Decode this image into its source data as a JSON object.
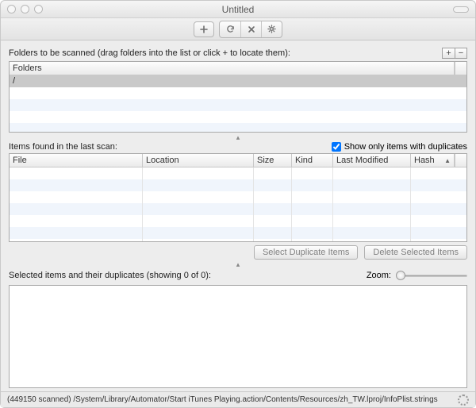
{
  "window": {
    "title": "Untitled"
  },
  "toolbar": {
    "add_tip": "Add",
    "refresh_tip": "Rescan",
    "stop_tip": "Stop",
    "settings_tip": "Settings"
  },
  "folders_section": {
    "label": "Folders to be scanned (drag folders into the list or click + to locate them):",
    "plus": "+",
    "minus": "−",
    "column_header": "Folders",
    "rows": [
      "/"
    ]
  },
  "items_section": {
    "label": "Items found in the last scan:",
    "checkbox_label": "Show only items with duplicates",
    "checkbox_checked": true,
    "columns": [
      "File",
      "Location",
      "Size",
      "Kind",
      "Last Modified",
      "Hash"
    ],
    "sort_col_index": 5,
    "sort_dir": "asc",
    "buttons": {
      "select_dup": "Select Duplicate Items",
      "delete_sel": "Delete Selected Items"
    }
  },
  "preview_section": {
    "label": "Selected items and their duplicates (showing 0 of 0):",
    "zoom_label": "Zoom:"
  },
  "status": {
    "text": "(449150 scanned)  /System/Library/Automator/Start iTunes Playing.action/Contents/Resources/zh_TW.lproj/InfoPlist.strings"
  }
}
